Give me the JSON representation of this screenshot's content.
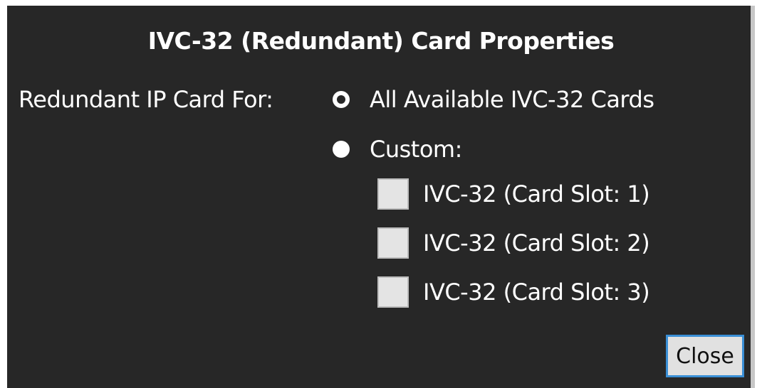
{
  "dialog": {
    "title": "IVC-32 (Redundant) Card Properties",
    "field_label": "Redundant IP Card For:",
    "options": [
      {
        "label": "All Available IVC-32 Cards",
        "selected": true
      },
      {
        "label": "Custom:",
        "selected": false
      }
    ],
    "cards": [
      {
        "label": "IVC-32 (Card Slot: 1)",
        "checked": false
      },
      {
        "label": "IVC-32 (Card Slot: 2)",
        "checked": false
      },
      {
        "label": "IVC-32 (Card Slot: 3)",
        "checked": false
      }
    ],
    "close_label": "Close"
  },
  "colors": {
    "background": "#272727",
    "text": "#ffffff",
    "checkbox_fill": "#e4e4e4",
    "button_border": "#3a8fd6"
  }
}
